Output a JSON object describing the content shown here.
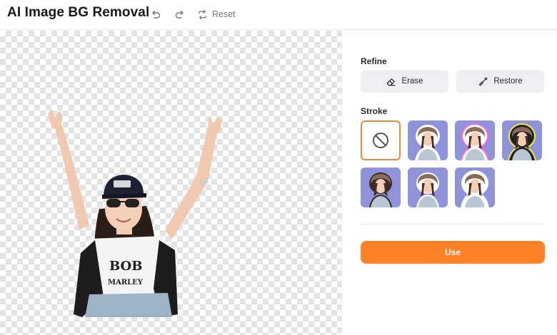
{
  "header": {
    "title": "AI Image BG Removal",
    "undo_icon": "undo-icon",
    "redo_icon": "redo-icon",
    "reset_label": "Reset"
  },
  "panel": {
    "refine_label": "Refine",
    "erase_label": "Erase",
    "restore_label": "Restore",
    "stroke_label": "Stroke",
    "use_label": "Use",
    "accent_color": "#ff8226",
    "stroke_options": [
      {
        "name": "none",
        "selected": true
      },
      {
        "name": "white",
        "glow": "#ffffff"
      },
      {
        "name": "pink",
        "glow": "#ff6bd6"
      },
      {
        "name": "yellow",
        "glow": "#f3e64a"
      },
      {
        "name": "thin-dark",
        "glow": "#3a2a2a"
      },
      {
        "name": "thin-white",
        "glow": "#ffffff"
      },
      {
        "name": "white-bold",
        "glow": "#ffffff"
      }
    ]
  }
}
